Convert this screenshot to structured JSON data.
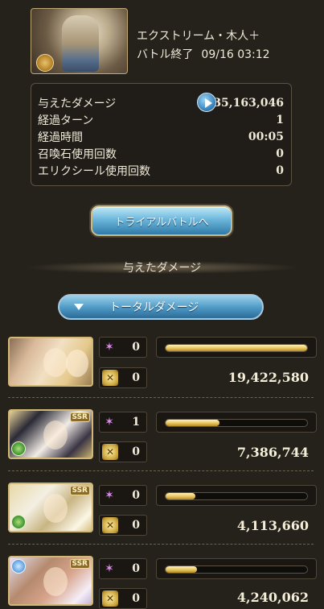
{
  "quest": {
    "title": "エクストリーム・木人＋",
    "status": "バトル終了",
    "timestamp": "09/16 03:12"
  },
  "stats": [
    {
      "label": "与えたダメージ",
      "value": "35,163,046"
    },
    {
      "label": "経過ターン",
      "value": "1"
    },
    {
      "label": "経過時間",
      "value": "00:05"
    },
    {
      "label": "召喚石使用回数",
      "value": "0"
    },
    {
      "label": "エリクシール使用回数",
      "value": "0"
    }
  ],
  "trial_button_label": "トライアルバトルへ",
  "section_title": "与えたダメージ",
  "dropdown": {
    "selected": "トータルダメージ"
  },
  "members": [
    {
      "portrait": "character-pair",
      "element": "",
      "rarity": "",
      "charge_attacks": "0",
      "skills": "0",
      "damage": "19,422,580",
      "bar_fraction": 1.0
    },
    {
      "portrait": "character",
      "element": "wind",
      "rarity": "SSR",
      "charge_attacks": "1",
      "skills": "0",
      "damage": "7,386,744",
      "bar_fraction": 0.38
    },
    {
      "portrait": "character",
      "element": "wind",
      "rarity": "SSR",
      "charge_attacks": "0",
      "skills": "0",
      "damage": "4,113,660",
      "bar_fraction": 0.21
    },
    {
      "portrait": "character",
      "element": "water",
      "rarity": "SSR",
      "charge_attacks": "0",
      "skills": "0",
      "damage": "4,240,062",
      "bar_fraction": 0.22
    }
  ],
  "icons": {
    "play": "play-icon",
    "charge_attack": "charge-attack-icon",
    "skill": "skill-icon",
    "dropdown_arrow": "chevron-down-icon"
  },
  "colors": {
    "background": "#25221c",
    "accent_blue": "#4d98c4",
    "bar_gold": "#e8c35c"
  }
}
